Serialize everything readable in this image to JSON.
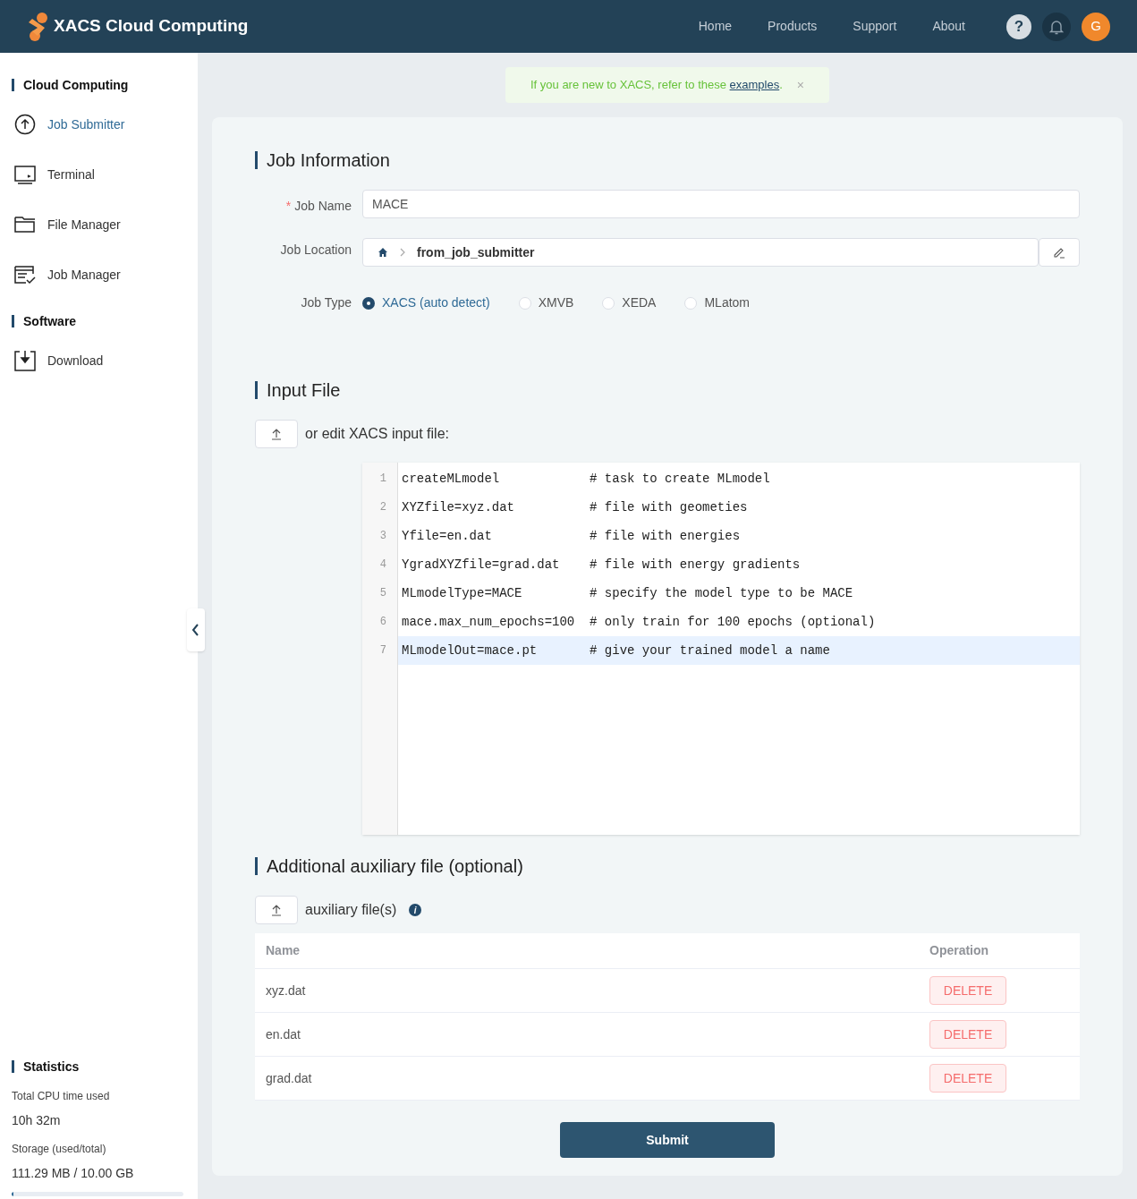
{
  "header": {
    "brand": "XACS Cloud Computing",
    "nav": [
      "Home",
      "Products",
      "Support",
      "About"
    ],
    "help": "?",
    "avatar": "G"
  },
  "sidebar": {
    "sections": [
      {
        "title": "Cloud Computing",
        "items": [
          {
            "label": "Job Submitter",
            "kind": "upload",
            "selected": true
          },
          {
            "label": "Terminal",
            "kind": "terminal",
            "selected": false
          },
          {
            "label": "File Manager",
            "kind": "folder",
            "selected": false
          },
          {
            "label": "Job Manager",
            "kind": "jobs",
            "selected": false
          }
        ]
      },
      {
        "title": "Software",
        "items": [
          {
            "label": "Download",
            "kind": "download",
            "selected": false
          }
        ]
      }
    ],
    "statistics": {
      "title": "Statistics",
      "cpu_label": "Total CPU time used",
      "cpu_value": "10h 32m",
      "storage_label": "Storage (used/total)",
      "storage_value": "111.29 MB / 10.00 GB",
      "level": 0.011
    }
  },
  "notice": {
    "text": "If you are new to XACS, refer to these",
    "link": "examples",
    "end": ".",
    "close": "×"
  },
  "job_information": {
    "title": "Job Information",
    "job_name_label": "Job Name",
    "required_mark": "*",
    "job_name": "MACE",
    "location_label": "Job Location",
    "location": "from_job_submitter",
    "job_type_label": "Job Type",
    "job_types": [
      {
        "label": "XACS (auto detect)",
        "selected": true
      },
      {
        "label": "XMVB",
        "selected": false
      },
      {
        "label": "XEDA",
        "selected": false
      },
      {
        "label": "MLatom",
        "selected": false
      }
    ]
  },
  "input_file": {
    "title": "Input File",
    "upload_label": "or edit XACS input file:",
    "lines": [
      {
        "number": "1",
        "text": "createMLmodel            # task to create MLmodel",
        "highlighted": false
      },
      {
        "number": "2",
        "text": "XYZfile=xyz.dat          # file with geometies",
        "highlighted": false
      },
      {
        "number": "3",
        "text": "Yfile=en.dat             # file with energies",
        "highlighted": false
      },
      {
        "number": "4",
        "text": "YgradXYZfile=grad.dat    # file with energy gradients",
        "highlighted": false
      },
      {
        "number": "5",
        "text": "MLmodelType=MACE         # specify the model type to be MACE",
        "highlighted": false
      },
      {
        "number": "6",
        "text": "mace.max_num_epochs=100  # only train for 100 epochs (optional)",
        "highlighted": false
      },
      {
        "number": "7",
        "text": "MLmodelOut=mace.pt       # give your trained model a name",
        "highlighted": true
      }
    ]
  },
  "auxiliary": {
    "title": "Additional auxiliary file (optional)",
    "upload_label": "auxiliary file(s)",
    "info": "i",
    "table": {
      "columns": [
        "Name",
        "Operation"
      ],
      "rows": [
        {
          "name": "xyz.dat",
          "action": "DELETE"
        },
        {
          "name": "en.dat",
          "action": "DELETE"
        },
        {
          "name": "grad.dat",
          "action": "DELETE"
        }
      ]
    }
  },
  "submit": "Submit"
}
